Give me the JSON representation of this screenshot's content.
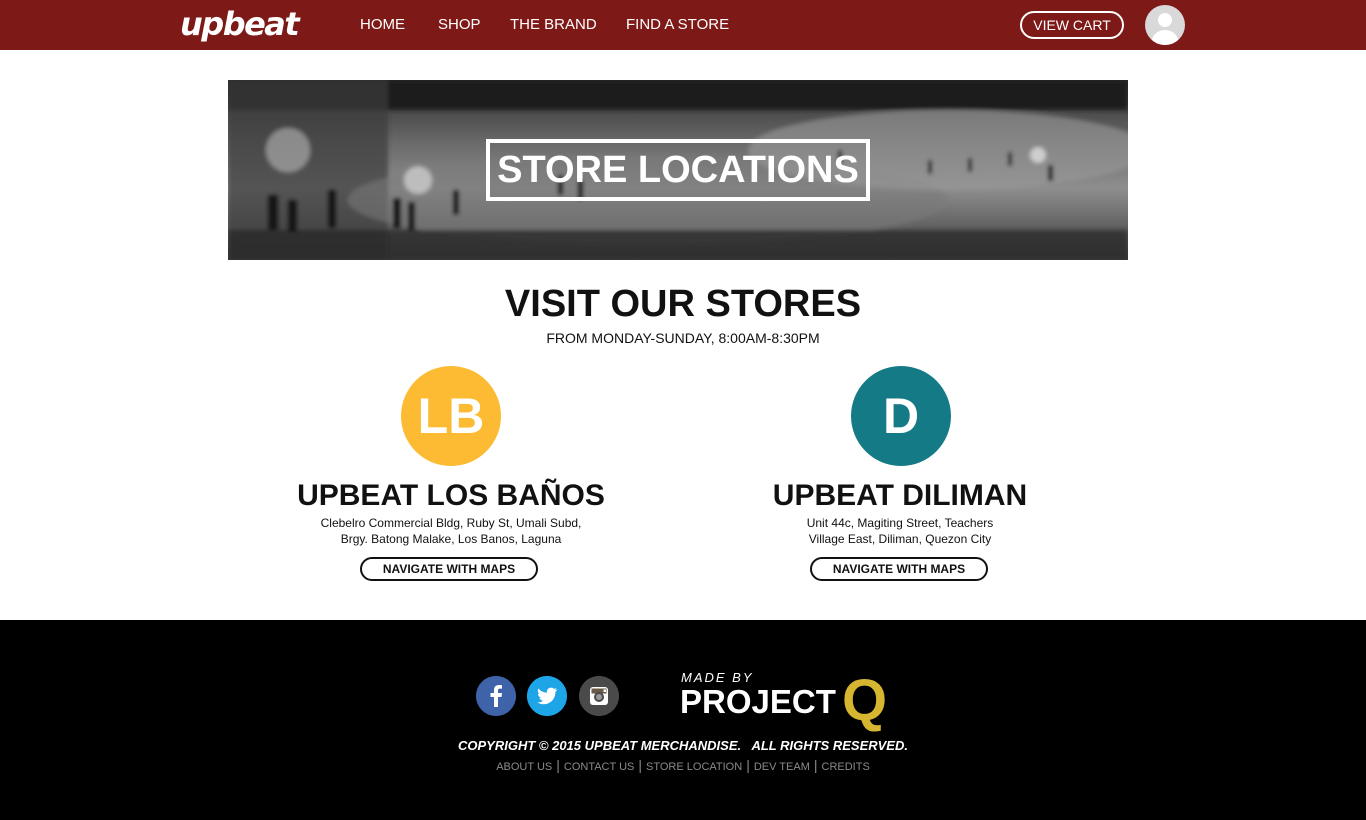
{
  "header": {
    "logo": "upbeat",
    "nav": [
      "HOME",
      "SHOP",
      "THE BRAND",
      "FIND A STORE"
    ],
    "cart_label": "VIEW CART"
  },
  "banner": {
    "title": "STORE LOCATIONS"
  },
  "main": {
    "title": "VISIT OUR STORES",
    "subtitle": "FROM MONDAY-SUNDAY, 8:00AM-8:30PM",
    "stores": [
      {
        "badge": "LB",
        "badge_color": "#fcbb32",
        "name": "UPBEAT LOS BAÑOS",
        "address_line1": "Clebelro Commercial Bldg, Ruby St, Umali Subd,",
        "address_line2": "Brgy. Batong Malake, Los Banos, Laguna",
        "button": "NAVIGATE WITH MAPS"
      },
      {
        "badge": "D",
        "badge_color": "#147a86",
        "name": "UPBEAT DILIMAN",
        "address_line1": "Unit 44c, Magiting Street, Teachers",
        "address_line2": "Village East, Diliman, Quezon City",
        "button": "NAVIGATE WITH MAPS"
      }
    ]
  },
  "footer": {
    "social": [
      "facebook-icon",
      "twitter-icon",
      "instagram-icon"
    ],
    "made_by": "MADE BY",
    "project": "PROJECT",
    "project_letter": "Q",
    "copyright": "COPYRIGHT © 2015 UPBEAT MERCHANDISE.   ALL RIGHTS RESERVED.",
    "links": [
      "ABOUT US",
      "CONTACT US",
      "STORE LOCATION",
      "DEV TEAM",
      "CREDITS"
    ]
  },
  "colors": {
    "header_bg": "#7d1a17",
    "footer_bg": "#000000",
    "accent_gold": "#d6b530"
  }
}
